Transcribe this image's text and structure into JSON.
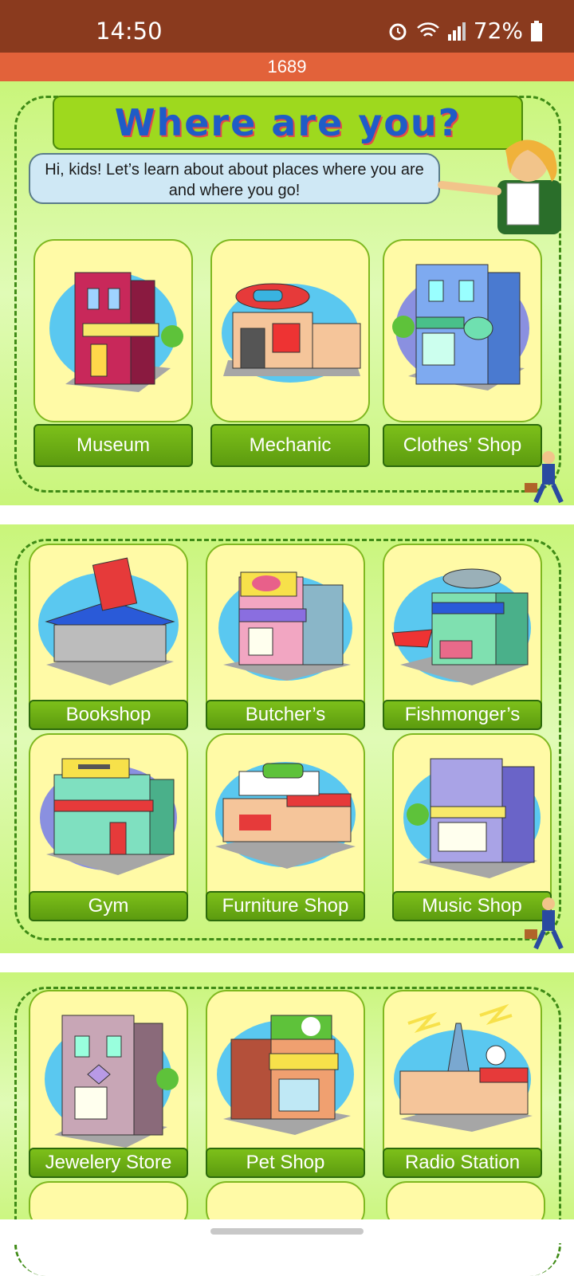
{
  "status": {
    "time": "14:50",
    "battery": "72%"
  },
  "topbar": {
    "counter": "1689"
  },
  "intro": {
    "title": "Where are you?",
    "bubble": "Hi, kids! Let’s learn about about places where you are and where you go!"
  },
  "places": [
    {
      "label": "Museum"
    },
    {
      "label": "Mechanic"
    },
    {
      "label": "Clothes’ Shop"
    },
    {
      "label": "Bookshop"
    },
    {
      "label": "Butcher’s"
    },
    {
      "label": "Fishmonger’s"
    },
    {
      "label": "Gym"
    },
    {
      "label": "Furniture Shop"
    },
    {
      "label": "Music Shop"
    },
    {
      "label": "Jewelery Store"
    },
    {
      "label": "Pet Shop"
    },
    {
      "label": "Radio Station"
    }
  ],
  "colors": {
    "status_bar": "#8a3a1e",
    "top_bar": "#e2623a",
    "panel": "#c9f57a",
    "label": "#6aab13",
    "card": "#fffaa6"
  }
}
